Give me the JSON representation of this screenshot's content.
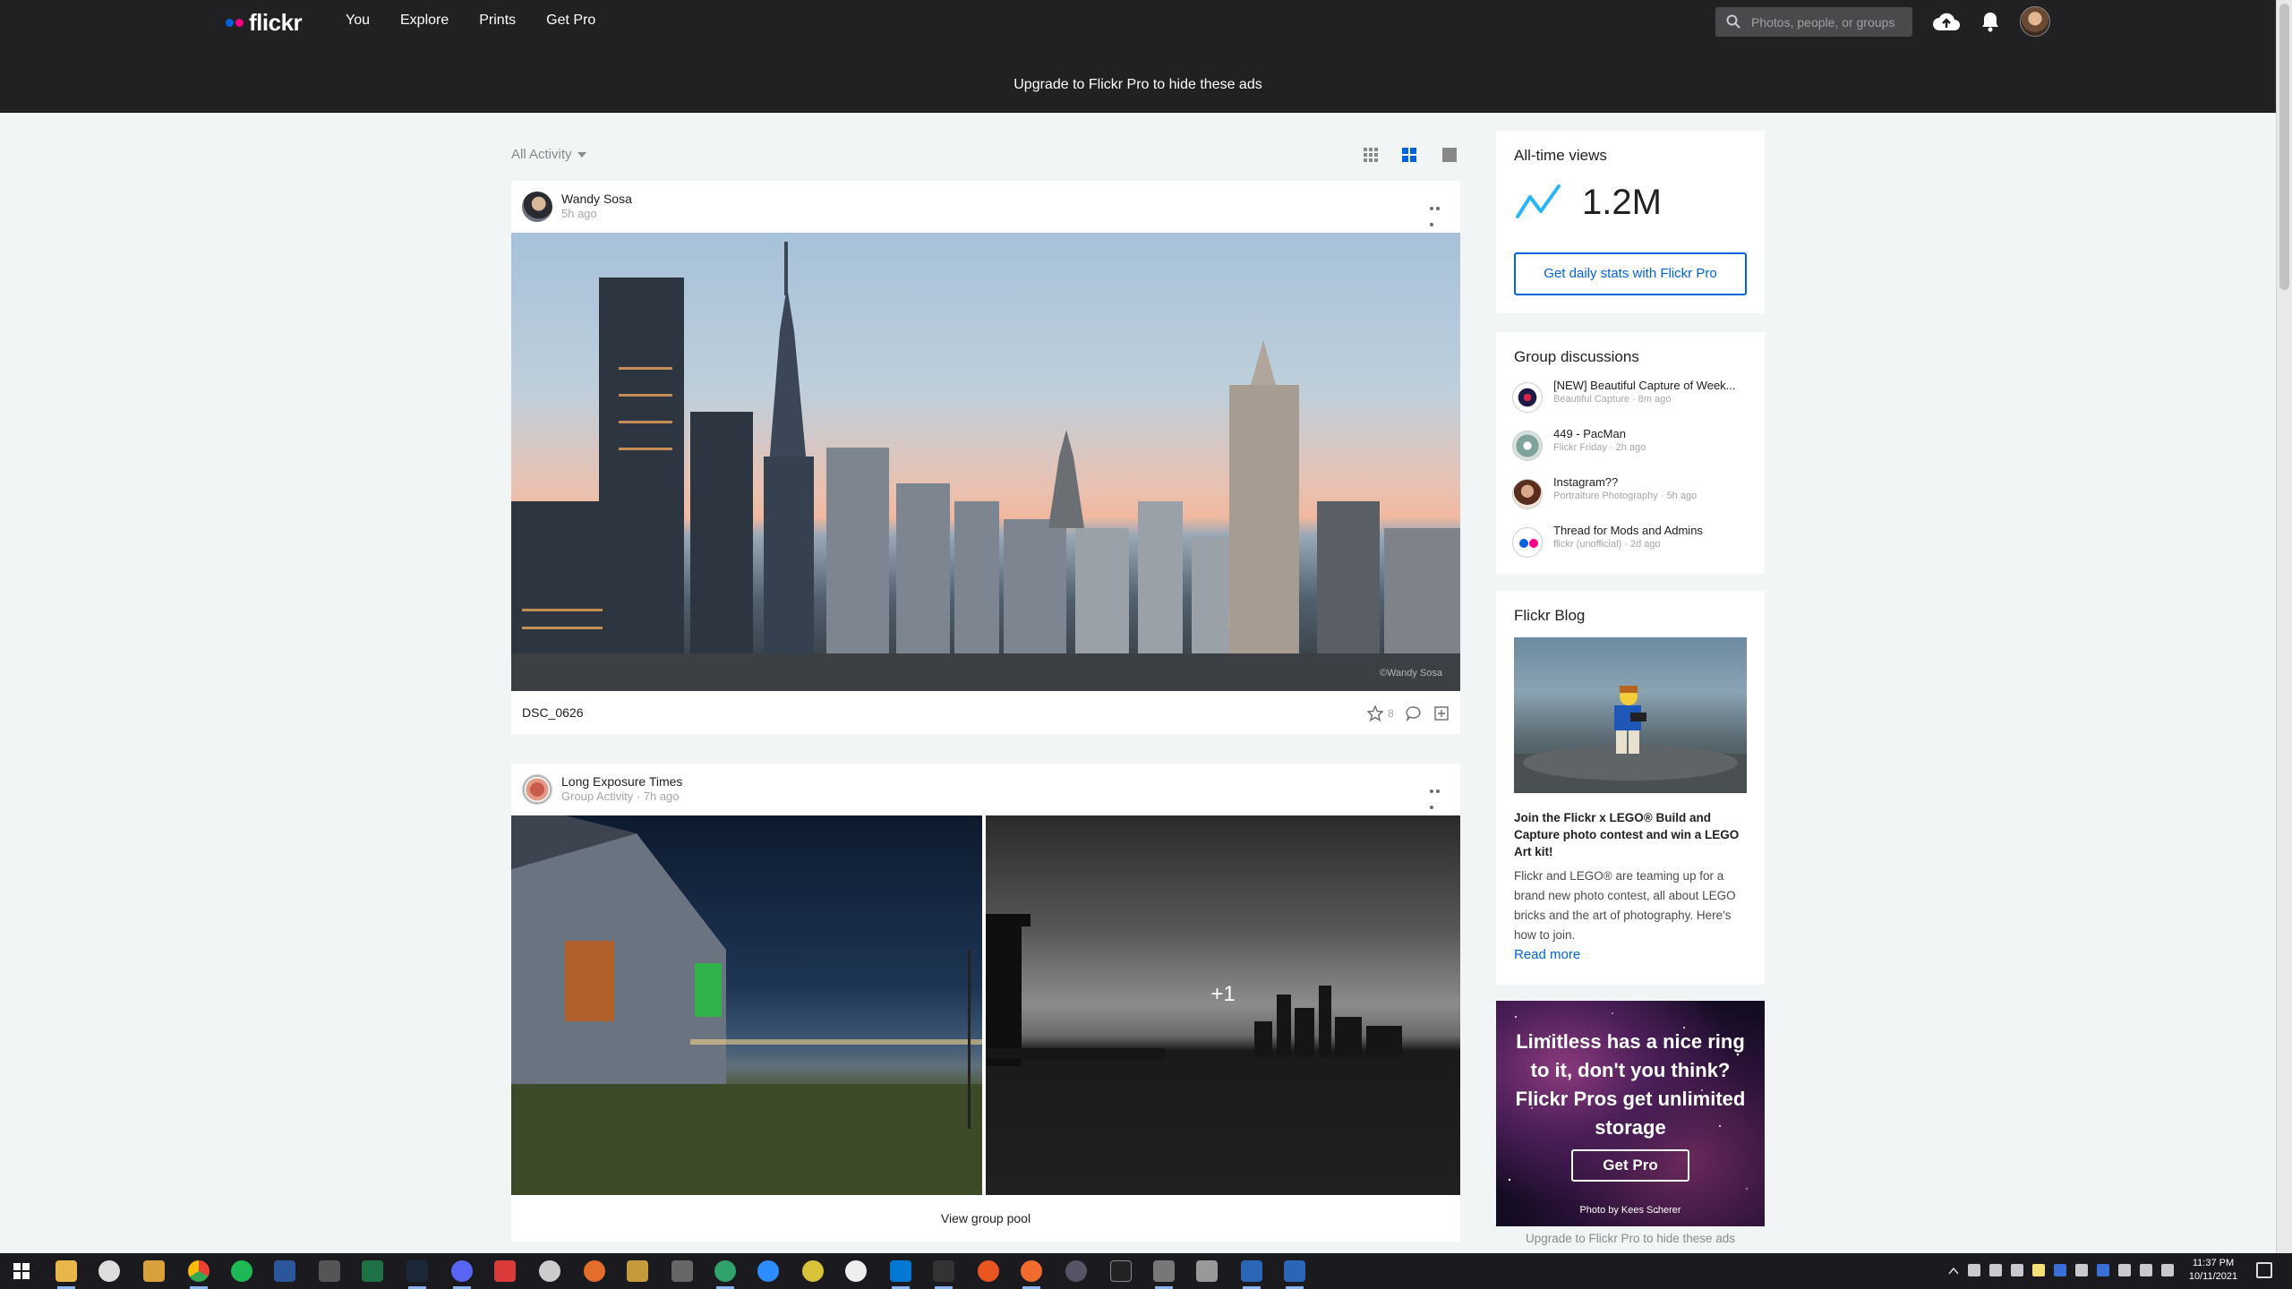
{
  "nav": {
    "logo_text": "flickr",
    "links": [
      "You",
      "Explore",
      "Prints",
      "Get Pro"
    ],
    "search_placeholder": "Photos, people, or groups",
    "ad_banner": "Upgrade to Flickr Pro to hide these ads"
  },
  "feed": {
    "filter_label": "All Activity",
    "posts": [
      {
        "author": "Wandy Sosa",
        "time": "5h ago",
        "photo_title": "DSC_0626",
        "fav_count": "8",
        "watermark": "©Wandy Sosa"
      },
      {
        "author": "Long Exposure Times",
        "meta": "Group Activity · 7h ago",
        "overflow_count": "+1",
        "view_pool": "View group pool"
      }
    ]
  },
  "sidebar": {
    "views": {
      "title": "All-time views",
      "value": "1.2M",
      "button": "Get daily stats with Flickr Pro"
    },
    "groups": {
      "title": "Group discussions",
      "items": [
        {
          "name": "[NEW] Beautiful Capture of Week...",
          "sub": "Beautiful Capture · 8m ago"
        },
        {
          "name": "449 - PacMan",
          "sub": "Flickr Friday · 2h ago"
        },
        {
          "name": "Instagram??",
          "sub": "Portraiture Photography · 5h ago"
        },
        {
          "name": "Thread for Mods and Admins",
          "sub": "flickr (unofficial) · 2d ago"
        }
      ]
    },
    "blog": {
      "title": "Flickr Blog",
      "headline": "Join the Flickr x LEGO® Build and Capture photo contest and win a LEGO Art kit!",
      "body": "Flickr and LEGO® are teaming up for a brand new photo contest, all about LEGO bricks and the art of photography. Here's how to join.",
      "read_more": "Read more"
    },
    "ad": {
      "text": "Limitless has a nice ring to it, don't you think? Flickr Pros get unlimited storage",
      "button": "Get Pro",
      "credit": "Photo by Kees Scherer",
      "footer": "Upgrade to Flickr Pro to hide these ads"
    }
  },
  "taskbar": {
    "time": "11:37 PM",
    "date": "10/11/2021"
  },
  "colors": {
    "brand_blue": "#0063dc",
    "brand_pink": "#ff0084",
    "nav_bg": "#212124",
    "page_bg": "#f2f5f6"
  }
}
